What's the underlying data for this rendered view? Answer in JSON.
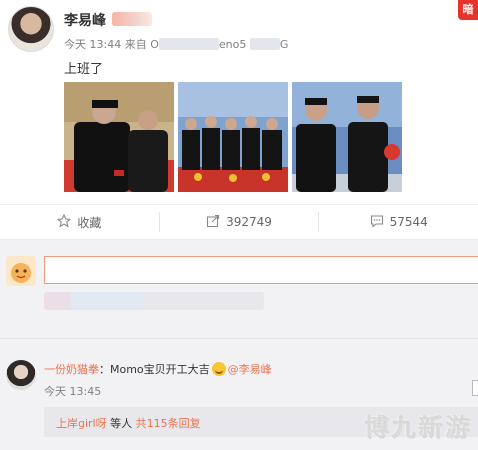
{
  "post": {
    "author": "李易峰",
    "time": "今天 13:44",
    "source_prefix": "来自 O",
    "source_mid": "eno5",
    "source_end": "G",
    "text": "上班了",
    "corner_logo": "暗"
  },
  "actions": [
    {
      "icon": "star-icon",
      "label": "收藏"
    },
    {
      "icon": "share-icon",
      "label": "392749"
    },
    {
      "icon": "comment-icon",
      "label": "57544"
    }
  ],
  "comment": {
    "user": "一份奶猫拳",
    "text_before": "：Momo宝贝开工大吉",
    "mention": "@李易峰",
    "time": "今天 13:45",
    "reply_user": "上岸girl呀",
    "reply_mid": " 等人 ",
    "reply_count": "共115条回复"
  },
  "watermark": "博九新游",
  "colors": {
    "accent": "#eb7350",
    "input_border": "#f29c7e",
    "comment_bg": "#f2f2f5"
  }
}
